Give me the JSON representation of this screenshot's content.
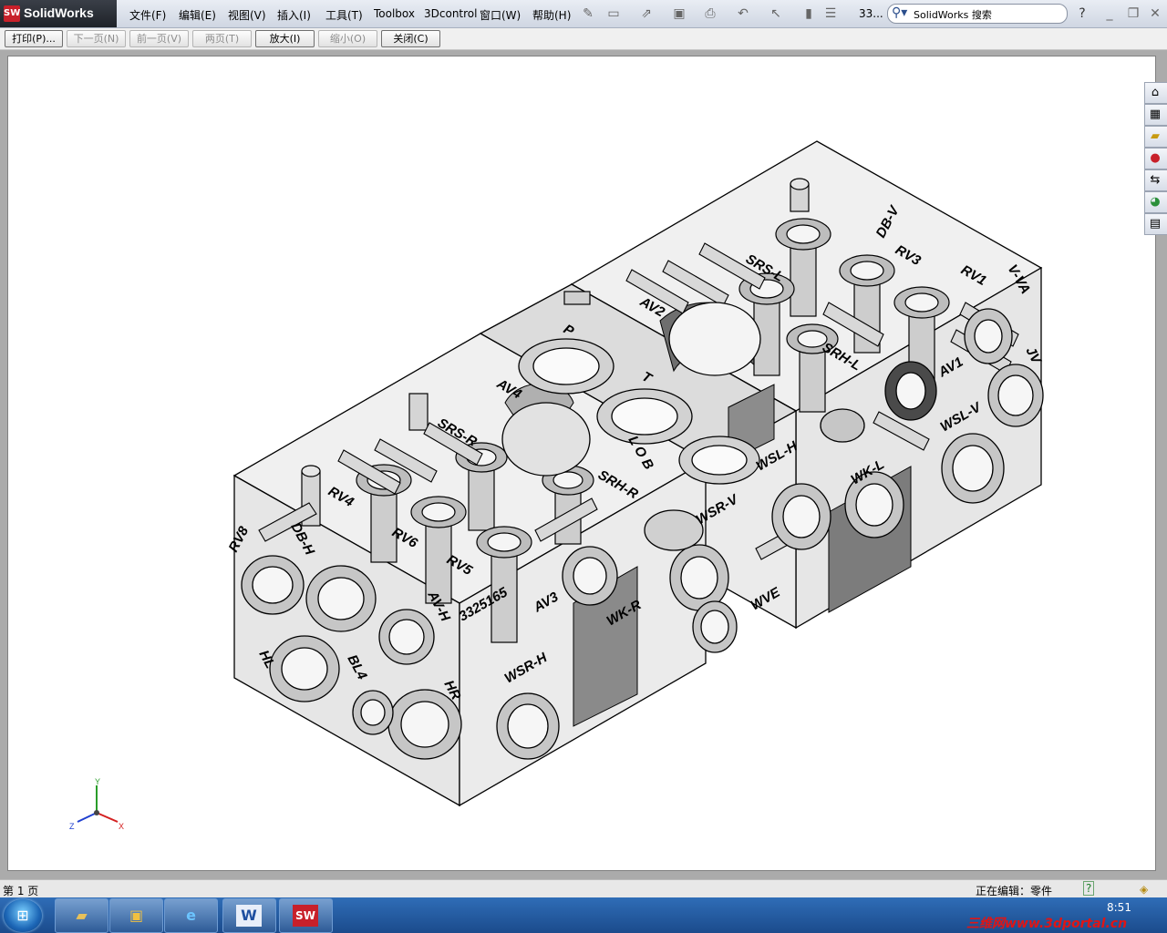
{
  "app": {
    "logo_ds": "SW",
    "name": "SolidWorks"
  },
  "menu": [
    "文件(F)",
    "编辑(E)",
    "视图(V)",
    "插入(I)",
    "工具(T)",
    "Toolbox",
    "3Dcontrol",
    "窗口(W)",
    "帮助(H)"
  ],
  "toolbar": {
    "doc_title": "33...",
    "help_icon": "?"
  },
  "search": {
    "text": "SolidWorks 搜索",
    "icon": "search-icon"
  },
  "preview_toolbar": {
    "print": "打印(P)...",
    "next_page": "下一页(N)",
    "prev_page": "前一页(V)",
    "two_page": "两页(T)",
    "zoom_in": "放大(I)",
    "zoom_out": "缩小(O)",
    "close": "关闭(C)"
  },
  "model_labels": {
    "top": [
      "P",
      "T",
      "AV2",
      "AV4",
      "SRS-L",
      "SRS-R",
      "DB-V",
      "RV3",
      "RV1",
      "V-VA"
    ],
    "front": [
      "RV8",
      "DB-H",
      "RV4",
      "RV6",
      "RV5",
      "SRH-R",
      "3325165",
      "AV3",
      "WK-R",
      "WSR-H",
      "AV-H",
      "BL4",
      "HR",
      "HL",
      "WSR-V",
      "WSL-H",
      "SRH-L",
      "WK-L",
      "WVE",
      "WSL-V",
      "AV1",
      "JV",
      "L O B"
    ]
  },
  "axes": {
    "x": "X",
    "y": "Y",
    "z": "Z"
  },
  "status": {
    "page": "第 1 页",
    "editing": "正在编辑：零件",
    "help": "?"
  },
  "taskbar": {
    "clock": "8:51",
    "watermark": "三维网www.3dportal.cn"
  },
  "colors": {
    "accent": "#c8202a",
    "taskbar": "#1b4b8c",
    "paper": "#ffffff"
  }
}
